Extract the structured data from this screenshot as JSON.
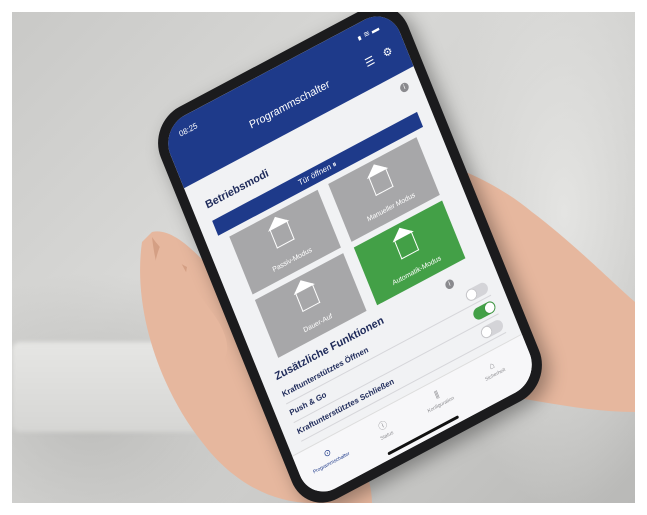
{
  "app": {
    "time": "08:25",
    "status_icons": "∎ ≋ ▬",
    "title": "Programmschalter",
    "menu_icon": "list-icon",
    "settings_icon": "gear-icon",
    "info_icon": "info-icon"
  },
  "operating_modes": {
    "heading": "Betriebsmodi",
    "door_open_label": "Tür öffnen",
    "modes": [
      {
        "label": "Manueller Modus",
        "active": false
      },
      {
        "label": "Passiv-Modus",
        "active": false
      },
      {
        "label": "Automatik-Modus",
        "active": true
      },
      {
        "label": "Dauer-Auf",
        "active": false
      }
    ],
    "active_color": "#43a047"
  },
  "additional_functions": {
    "heading": "Zusätzliche Funktionen",
    "items": [
      {
        "label": "Kraftunterstütztes Öffnen",
        "on": false
      },
      {
        "label": "Push & Go",
        "on": true
      },
      {
        "label": "Kraftunterstütztes Schließen",
        "on": false
      }
    ]
  },
  "tabbar": {
    "tabs": [
      {
        "label": "Programmschalter",
        "icon": "toggle-icon",
        "active": true
      },
      {
        "label": "Status",
        "icon": "info-icon",
        "active": false
      },
      {
        "label": "Konfiguration",
        "icon": "sliders-icon",
        "active": false
      },
      {
        "label": "Sicherheit",
        "icon": "lock-icon",
        "active": false
      }
    ]
  },
  "colors": {
    "brand": "#1e3a8a",
    "toggle_on": "#43a047"
  }
}
